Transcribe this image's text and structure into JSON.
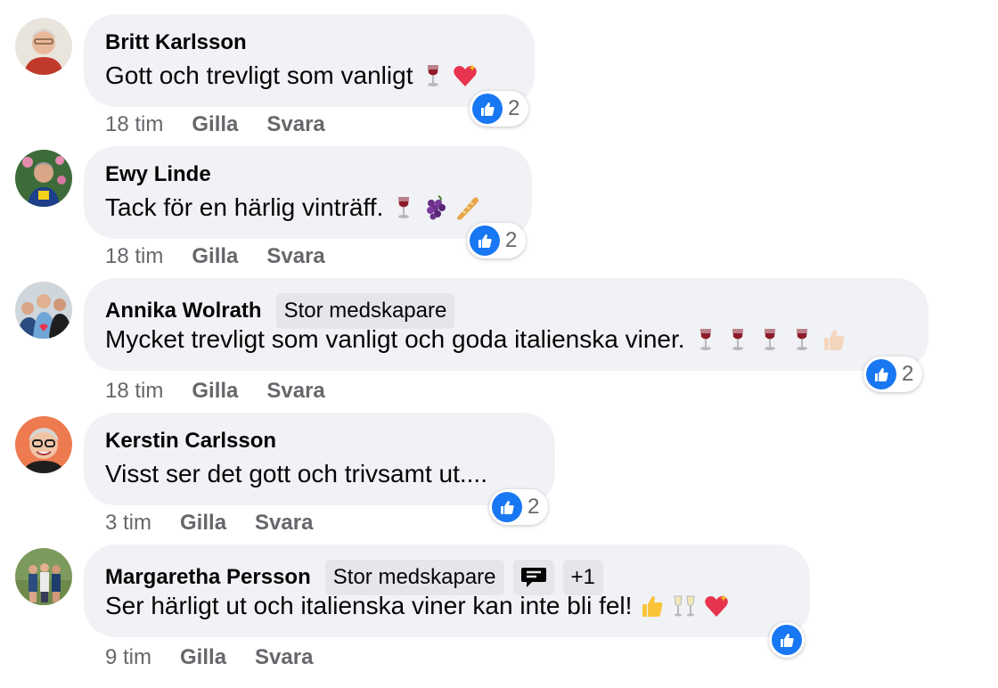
{
  "comments": [
    {
      "author": "Britt Karlsson",
      "text": "Gott och trevligt som vanligt",
      "emojis": [
        "wine-glass",
        "sparkling-heart"
      ],
      "reaction_count": "2",
      "time": "18 tim",
      "like_label": "Gilla",
      "reply_label": "Svara"
    },
    {
      "author": "Ewy Linde",
      "text": "Tack för en härlig vinträff.",
      "emojis": [
        "wine-glass",
        "grapes",
        "baguette"
      ],
      "reaction_count": "2",
      "time": "18 tim",
      "like_label": "Gilla",
      "reply_label": "Svara"
    },
    {
      "author": "Annika Wolrath",
      "badge": "Stor medskapare",
      "text": "Mycket trevligt som vanligt och goda italienska viner.",
      "emojis": [
        "wine-glass",
        "wine-glass",
        "wine-glass",
        "wine-glass",
        "thumbs-up"
      ],
      "reaction_count": "2",
      "time": "18 tim",
      "like_label": "Gilla",
      "reply_label": "Svara"
    },
    {
      "author": "Kerstin Carlsson",
      "text": "Visst ser det gott och trivsamt ut....",
      "emojis": [],
      "reaction_count": "2",
      "time": "3 tim",
      "like_label": "Gilla",
      "reply_label": "Svara"
    },
    {
      "author": "Margaretha Persson",
      "badge": "Stor medskapare",
      "badge_extra": "+1",
      "badge_icon": "conversation-starter-icon",
      "text": "Ser härligt ut och italienska viner kan inte bli fel!",
      "emojis": [
        "thumbs-up",
        "clinking-glasses",
        "sparkling-heart"
      ],
      "reaction_count": "",
      "time": "9 tim",
      "like_label": "Gilla",
      "reply_label": "Svara"
    }
  ],
  "colors": {
    "bubble": "#f0f2f5",
    "like_blue": "#1877f2",
    "meta_gray": "#65676b"
  }
}
